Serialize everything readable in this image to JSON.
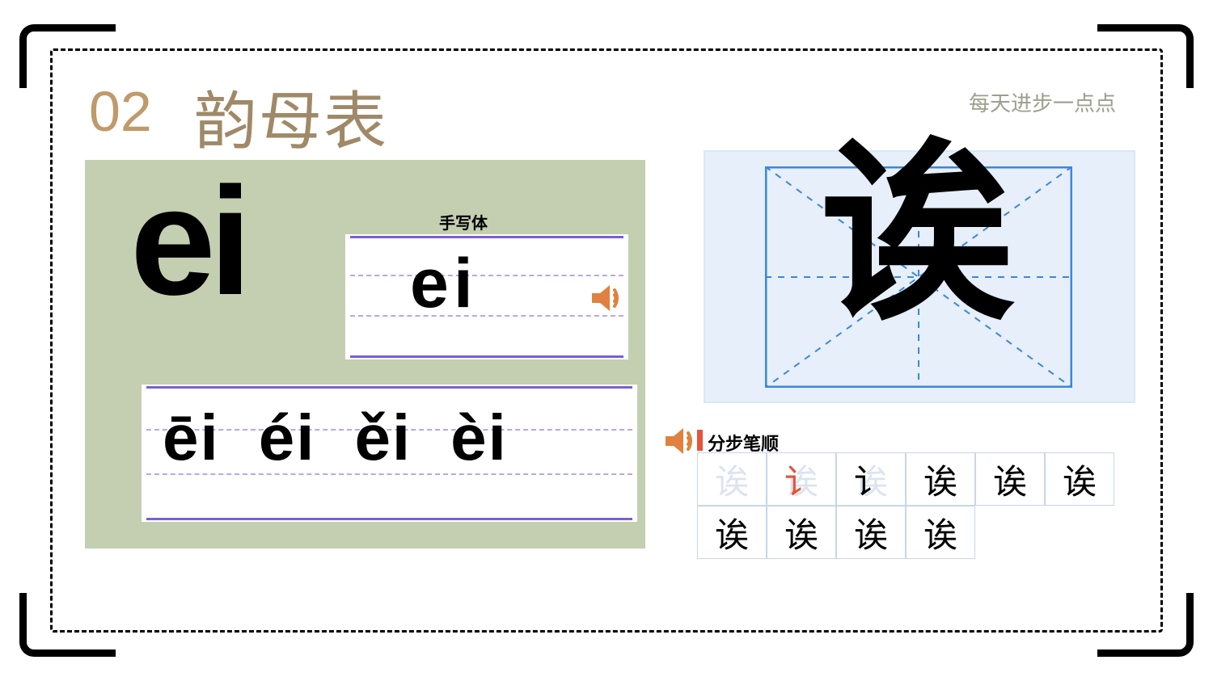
{
  "header": {
    "section_number": "02",
    "title": "韵母表",
    "motto": "每天进步一点点"
  },
  "pinyin": {
    "main": "ei",
    "handwriting_label": "手写体",
    "handwriting_sample": "ei",
    "tones": [
      "ēi",
      "éi",
      "ěi",
      "èi"
    ]
  },
  "character": {
    "glyph": "诶",
    "stroke_label": "分步笔顺",
    "stroke_steps": [
      "讠",
      "讠",
      "讠",
      "诶",
      "诶",
      "诶",
      "诶",
      "诶",
      "诶",
      "诶"
    ]
  },
  "colors": {
    "sage": "#c4cfb2",
    "accent": "#c09a6b",
    "rule": "#7a5fd6",
    "speaker": "#e0813f"
  }
}
